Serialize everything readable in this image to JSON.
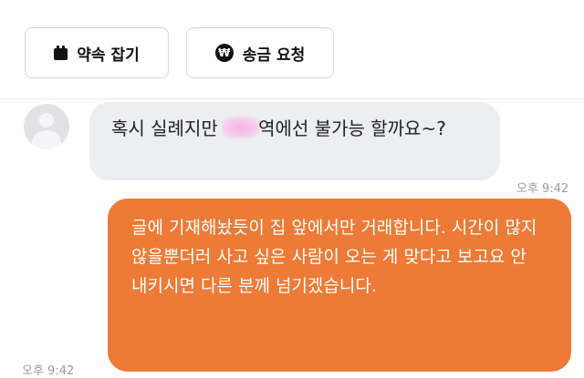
{
  "toolbar": {
    "appointment_label": "약속 잡기",
    "remit_label": "송금 요청",
    "remit_icon_glyph": "₩"
  },
  "chat": {
    "incoming": {
      "text_before": "혹시 실례지만 ",
      "text_after": "역에선 불가능 할까요~?",
      "time": "오후 9:42"
    },
    "outgoing": {
      "text": "글에 기재해놨듯이 집 앞에서만 거래합니다. 시간이 많지 않을뿐더러 사고 싶은 사람이 오는 게 맞다고 보고요 안 내키시면 다른 분께 넘기겠습니다.",
      "time": "오후 9:42"
    }
  },
  "colors": {
    "outgoing_bubble": "#ed7a36",
    "incoming_bubble": "#eceef2",
    "censor_blur": "#f4b3e4"
  },
  "icons": [
    "calendar-icon",
    "won-coin-icon",
    "avatar-placeholder-icon"
  ]
}
